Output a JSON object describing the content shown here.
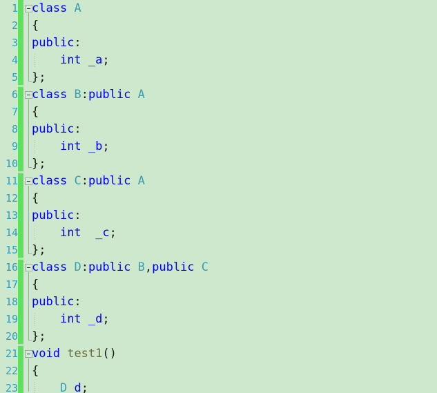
{
  "editor": {
    "name": "code-editor",
    "language": "C++",
    "background_color": "#cde8cd",
    "change_bar_color": "#5fe05f",
    "keyword_color": "#0000ff",
    "type_color": "#3a9fb0",
    "function_color": "#6b6b3a",
    "punctuation_color": "#1a1a1a",
    "line_number_color": "#2e9ec4",
    "line_height_px": 25,
    "first_visible_line": 1
  },
  "gutter": {
    "line_numbers": [
      "1",
      "2",
      "3",
      "4",
      "5",
      "6",
      "7",
      "8",
      "9",
      "10",
      "11",
      "12",
      "13",
      "14",
      "15",
      "16",
      "17",
      "18",
      "19",
      "20",
      "21",
      "22",
      "23"
    ]
  },
  "fold_markers": [
    {
      "line": 1,
      "state": "expanded",
      "glyph": "minus"
    },
    {
      "line": 6,
      "state": "expanded",
      "glyph": "minus"
    },
    {
      "line": 11,
      "state": "expanded",
      "glyph": "minus"
    },
    {
      "line": 16,
      "state": "expanded",
      "glyph": "minus"
    },
    {
      "line": 21,
      "state": "expanded",
      "glyph": "minus"
    }
  ],
  "code_lines": [
    {
      "n": 1,
      "indent": 0,
      "tokens": [
        {
          "t": "class",
          "c": "kw"
        },
        {
          "t": " ",
          "c": "pun"
        },
        {
          "t": "A",
          "c": "type"
        }
      ]
    },
    {
      "n": 2,
      "indent": 0,
      "tokens": [
        {
          "t": "{",
          "c": "pun"
        }
      ]
    },
    {
      "n": 3,
      "indent": 0,
      "tokens": [
        {
          "t": "public",
          "c": "kw"
        },
        {
          "t": ":",
          "c": "pun"
        }
      ]
    },
    {
      "n": 4,
      "indent": 0,
      "tokens": [
        {
          "t": "    ",
          "c": "pun"
        },
        {
          "t": "int",
          "c": "kw"
        },
        {
          "t": " ",
          "c": "pun"
        },
        {
          "t": "_a",
          "c": "var"
        },
        {
          "t": ";",
          "c": "pun"
        }
      ]
    },
    {
      "n": 5,
      "indent": 0,
      "tokens": [
        {
          "t": "}",
          "c": "pun"
        },
        {
          "t": ";",
          "c": "pun"
        }
      ]
    },
    {
      "n": 6,
      "indent": 0,
      "tokens": [
        {
          "t": "class",
          "c": "kw"
        },
        {
          "t": " ",
          "c": "pun"
        },
        {
          "t": "B",
          "c": "type"
        },
        {
          "t": ":",
          "c": "pun"
        },
        {
          "t": "public",
          "c": "kw"
        },
        {
          "t": " ",
          "c": "pun"
        },
        {
          "t": "A",
          "c": "type"
        }
      ]
    },
    {
      "n": 7,
      "indent": 0,
      "tokens": [
        {
          "t": "{",
          "c": "pun"
        }
      ]
    },
    {
      "n": 8,
      "indent": 0,
      "tokens": [
        {
          "t": "public",
          "c": "kw"
        },
        {
          "t": ":",
          "c": "pun"
        }
      ]
    },
    {
      "n": 9,
      "indent": 0,
      "tokens": [
        {
          "t": "    ",
          "c": "pun"
        },
        {
          "t": "int",
          "c": "kw"
        },
        {
          "t": " ",
          "c": "pun"
        },
        {
          "t": "_b",
          "c": "var"
        },
        {
          "t": ";",
          "c": "pun"
        }
      ]
    },
    {
      "n": 10,
      "indent": 0,
      "tokens": [
        {
          "t": "}",
          "c": "pun"
        },
        {
          "t": ";",
          "c": "pun"
        }
      ]
    },
    {
      "n": 11,
      "indent": 0,
      "tokens": [
        {
          "t": "class",
          "c": "kw"
        },
        {
          "t": " ",
          "c": "pun"
        },
        {
          "t": "C",
          "c": "type"
        },
        {
          "t": ":",
          "c": "pun"
        },
        {
          "t": "public",
          "c": "kw"
        },
        {
          "t": " ",
          "c": "pun"
        },
        {
          "t": "A",
          "c": "type"
        }
      ]
    },
    {
      "n": 12,
      "indent": 0,
      "tokens": [
        {
          "t": "{",
          "c": "pun"
        }
      ]
    },
    {
      "n": 13,
      "indent": 0,
      "tokens": [
        {
          "t": "public",
          "c": "kw"
        },
        {
          "t": ":",
          "c": "pun"
        }
      ]
    },
    {
      "n": 14,
      "indent": 0,
      "tokens": [
        {
          "t": "    ",
          "c": "pun"
        },
        {
          "t": "int",
          "c": "kw"
        },
        {
          "t": "  ",
          "c": "pun"
        },
        {
          "t": "_c",
          "c": "var"
        },
        {
          "t": ";",
          "c": "pun"
        }
      ]
    },
    {
      "n": 15,
      "indent": 0,
      "tokens": [
        {
          "t": "}",
          "c": "pun"
        },
        {
          "t": ";",
          "c": "pun"
        }
      ]
    },
    {
      "n": 16,
      "indent": 0,
      "tokens": [
        {
          "t": "class",
          "c": "kw"
        },
        {
          "t": " ",
          "c": "pun"
        },
        {
          "t": "D",
          "c": "type"
        },
        {
          "t": ":",
          "c": "pun"
        },
        {
          "t": "public",
          "c": "kw"
        },
        {
          "t": " ",
          "c": "pun"
        },
        {
          "t": "B",
          "c": "type"
        },
        {
          "t": ",",
          "c": "pun"
        },
        {
          "t": "public",
          "c": "kw"
        },
        {
          "t": " ",
          "c": "pun"
        },
        {
          "t": "C",
          "c": "type"
        }
      ]
    },
    {
      "n": 17,
      "indent": 0,
      "tokens": [
        {
          "t": "{",
          "c": "pun"
        }
      ]
    },
    {
      "n": 18,
      "indent": 0,
      "tokens": [
        {
          "t": "public",
          "c": "kw"
        },
        {
          "t": ":",
          "c": "pun"
        }
      ]
    },
    {
      "n": 19,
      "indent": 0,
      "tokens": [
        {
          "t": "    ",
          "c": "pun"
        },
        {
          "t": "int",
          "c": "kw"
        },
        {
          "t": " ",
          "c": "pun"
        },
        {
          "t": "_d",
          "c": "var"
        },
        {
          "t": ";",
          "c": "pun"
        }
      ]
    },
    {
      "n": 20,
      "indent": 0,
      "tokens": [
        {
          "t": "}",
          "c": "pun"
        },
        {
          "t": ";",
          "c": "pun"
        }
      ]
    },
    {
      "n": 21,
      "indent": 0,
      "tokens": [
        {
          "t": "void",
          "c": "kw"
        },
        {
          "t": " ",
          "c": "pun"
        },
        {
          "t": "test1",
          "c": "fn"
        },
        {
          "t": "()",
          "c": "pun"
        }
      ]
    },
    {
      "n": 22,
      "indent": 0,
      "tokens": [
        {
          "t": "{",
          "c": "pun"
        }
      ]
    },
    {
      "n": 23,
      "indent": 0,
      "tokens": [
        {
          "t": "    ",
          "c": "pun"
        },
        {
          "t": "D",
          "c": "type"
        },
        {
          "t": " ",
          "c": "pun"
        },
        {
          "t": "d",
          "c": "var"
        },
        {
          "t": ";",
          "c": "pun"
        }
      ]
    }
  ],
  "plain_text": "class A\n{\npublic:\n    int _a;\n};\nclass B:public A\n{\npublic:\n    int _b;\n};\nclass C:public A\n{\npublic:\n    int  _c;\n};\nclass D:public B,public C\n{\npublic:\n    int _d;\n};\nvoid test1()\n{\n    D d;"
}
